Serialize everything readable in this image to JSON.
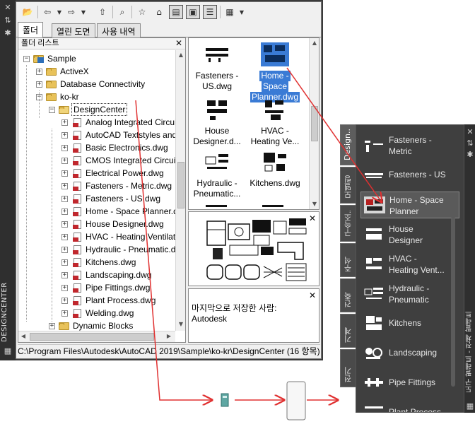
{
  "design_center": {
    "rail_title": "DESIGNCENTER",
    "tabs": [
      {
        "label": "폴더",
        "active": true
      },
      {
        "label": "열린 도면",
        "active": false
      },
      {
        "label": "사용 내역",
        "active": false
      }
    ],
    "tree_header": "폴더 리스트",
    "tree": [
      {
        "label": "Sample",
        "kind": "folder",
        "expander": "−"
      },
      {
        "label": "ActiveX",
        "kind": "folder",
        "expander": "+"
      },
      {
        "label": "Database Connectivity",
        "kind": "folder",
        "expander": "+"
      },
      {
        "label": "ko-kr",
        "kind": "folder",
        "expander": "−"
      },
      {
        "label": "DesignCenter",
        "kind": "folder-open",
        "expander": "−",
        "selected": true
      },
      {
        "label": "Analog Integrated Circuits.dwg",
        "kind": "dwg",
        "expander": "+"
      },
      {
        "label": "AutoCAD Textstyles and Linetypes.dwg",
        "kind": "dwg",
        "expander": "+"
      },
      {
        "label": "Basic Electronics.dwg",
        "kind": "dwg",
        "expander": "+"
      },
      {
        "label": "CMOS Integrated Circuits.dwg",
        "kind": "dwg",
        "expander": "+"
      },
      {
        "label": "Electrical Power.dwg",
        "kind": "dwg",
        "expander": "+"
      },
      {
        "label": "Fasteners - Metric.dwg",
        "kind": "dwg",
        "expander": "+"
      },
      {
        "label": "Fasteners - US.dwg",
        "kind": "dwg",
        "expander": "+"
      },
      {
        "label": "Home - Space Planner.dwg",
        "kind": "dwg",
        "expander": "+"
      },
      {
        "label": "House Designer.dwg",
        "kind": "dwg",
        "expander": "+"
      },
      {
        "label": "HVAC - Heating Ventilation.dwg",
        "kind": "dwg",
        "expander": "+"
      },
      {
        "label": "Hydraulic - Pneumatic.dwg",
        "kind": "dwg",
        "expander": "+"
      },
      {
        "label": "Kitchens.dwg",
        "kind": "dwg",
        "expander": "+"
      },
      {
        "label": "Landscaping.dwg",
        "kind": "dwg",
        "expander": "+"
      },
      {
        "label": "Pipe Fittings.dwg",
        "kind": "dwg",
        "expander": "+"
      },
      {
        "label": "Plant Process.dwg",
        "kind": "dwg",
        "expander": "+"
      },
      {
        "label": "Welding.dwg",
        "kind": "dwg",
        "expander": "+"
      },
      {
        "label": "Dynamic Blocks",
        "kind": "folder",
        "expander": "+"
      }
    ],
    "content_tiles": [
      {
        "label_lines": [
          "Fasteners -",
          "US.dwg"
        ],
        "selected": false
      },
      {
        "label_lines": [
          "Home -",
          "Space",
          "Planner.dwg"
        ],
        "selected": true
      },
      {
        "label_lines": [
          "House",
          "Designer.d..."
        ],
        "selected": false
      },
      {
        "label_lines": [
          "HVAC -",
          "Heating Ve..."
        ],
        "selected": false
      },
      {
        "label_lines": [
          "Hydraulic -",
          "Pneumatic..."
        ],
        "selected": false
      },
      {
        "label_lines": [
          "Kitchens.dwg"
        ],
        "selected": false
      }
    ],
    "description_lines": [
      "마지막으로 저장한 사람:",
      "Autodesk"
    ],
    "status_path": "C:\\Program Files\\Autodesk\\AutoCAD 2019\\Sample\\ko-kr\\DesignCenter (16 항목)"
  },
  "tool_palettes": {
    "rail_title": "도구 팔레트 - 전체 팔레트",
    "tabs": [
      {
        "label": "Design...",
        "active": true
      },
      {
        "label": "모델링",
        "active": false
      },
      {
        "label": "구속조...",
        "active": false
      },
      {
        "label": "주석",
        "active": false
      },
      {
        "label": "건축",
        "active": false
      },
      {
        "label": "기계",
        "active": false
      },
      {
        "label": "전기",
        "active": false
      }
    ],
    "items": [
      {
        "label_lines": [
          "Fasteners -",
          "Metric"
        ],
        "selected": false
      },
      {
        "label_lines": [
          "Fasteners - US"
        ],
        "selected": false
      },
      {
        "label_lines": [
          "Home - Space",
          "Planner"
        ],
        "selected": true
      },
      {
        "label_lines": [
          "House",
          "Designer"
        ],
        "selected": false
      },
      {
        "label_lines": [
          "HVAC -",
          "Heating  Vent..."
        ],
        "selected": false
      },
      {
        "label_lines": [
          "Hydraulic -",
          "Pneumatic"
        ],
        "selected": false
      },
      {
        "label_lines": [
          "Kitchens"
        ],
        "selected": false
      },
      {
        "label_lines": [
          "Landscaping"
        ],
        "selected": false
      },
      {
        "label_lines": [
          "Pipe Fittings"
        ],
        "selected": false
      },
      {
        "label_lines": [
          "Plant Process"
        ],
        "selected": false
      }
    ]
  },
  "colors": {
    "annotation_arrow": "#e03030",
    "selection": "#3a7bd5",
    "dark_panel": "#3f3f3f"
  },
  "icons": [
    "open-icon",
    "back-icon",
    "forward-icon",
    "up-icon",
    "search-icon",
    "favorites-icon",
    "home-icon",
    "tree-view-icon",
    "preview-icon",
    "description-icon",
    "views-icon",
    "close-icon",
    "autohide-icon",
    "properties-icon"
  ]
}
